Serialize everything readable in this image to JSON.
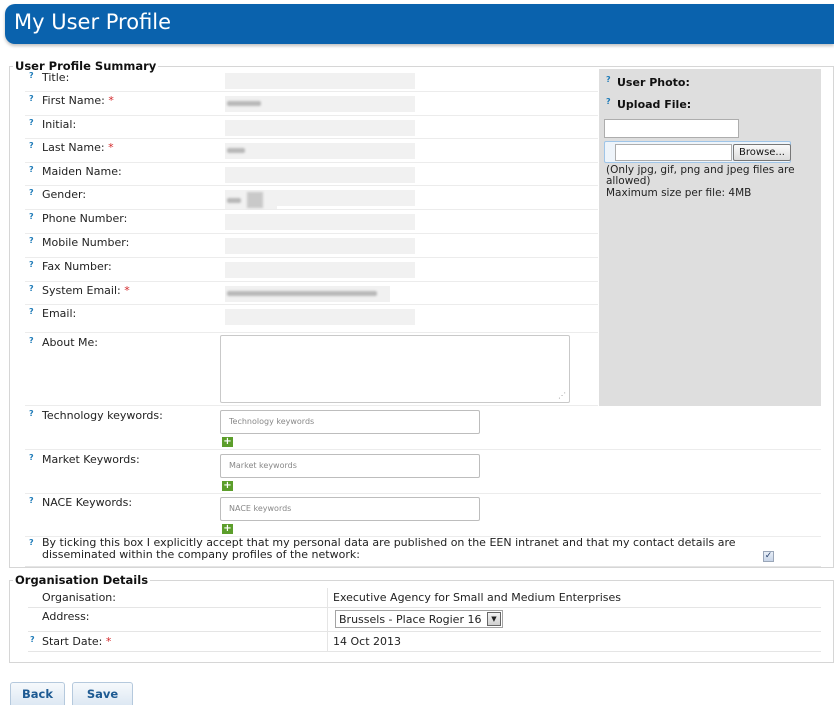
{
  "header": {
    "title": "My User Profile"
  },
  "summary": {
    "legend": "User Profile Summary",
    "help_glyph": "?",
    "required_mark": "*",
    "fields": [
      {
        "label": "Title:",
        "required": false
      },
      {
        "label": "First Name:",
        "required": true
      },
      {
        "label": "Initial:",
        "required": false
      },
      {
        "label": "Last Name:",
        "required": true
      },
      {
        "label": "Maiden Name:",
        "required": false
      },
      {
        "label": "Gender:",
        "required": false
      },
      {
        "label": "Phone Number:",
        "required": false
      },
      {
        "label": "Mobile Number:",
        "required": false
      },
      {
        "label": "Fax Number:",
        "required": false
      },
      {
        "label": "System Email:",
        "required": true
      },
      {
        "label": "Email:",
        "required": false
      }
    ],
    "about_me_label": "About Me:",
    "keywords": [
      {
        "label": "Technology keywords:",
        "placeholder": "Technology keywords"
      },
      {
        "label": "Market Keywords:",
        "placeholder": "Market keywords"
      },
      {
        "label": "NACE Keywords:",
        "placeholder": "NACE keywords"
      }
    ],
    "add_glyph": "+",
    "consent_text": "By ticking this box I explicitly accept that my personal data are published on the EEN intranet and that my contact details are disseminated within the company profiles of the network:",
    "consent_checked": true
  },
  "photo": {
    "user_photo_label": "User Photo:",
    "upload_label": "Upload File:",
    "browse_label": "Browse...",
    "note_line1": "(Only jpg, gif, png and jpeg files are",
    "note_line2": "allowed)",
    "max_size": "Maximum size per file: 4MB"
  },
  "organisation": {
    "legend": "Organisation Details",
    "organisation_label": "Organisation:",
    "organisation_value": "Executive Agency for Small and Medium Enterprises",
    "address_label": "Address:",
    "address_value": "Brussels - Place Rogier 16",
    "start_date_label": "Start Date:",
    "start_date_value": "14 Oct 2013"
  },
  "buttons": {
    "back": "Back",
    "save": "Save"
  },
  "colors": {
    "header": "#0a62ad",
    "help_icon": "#1e7bb8",
    "required": "#d3282b",
    "add_button": "#5c9e2b"
  }
}
